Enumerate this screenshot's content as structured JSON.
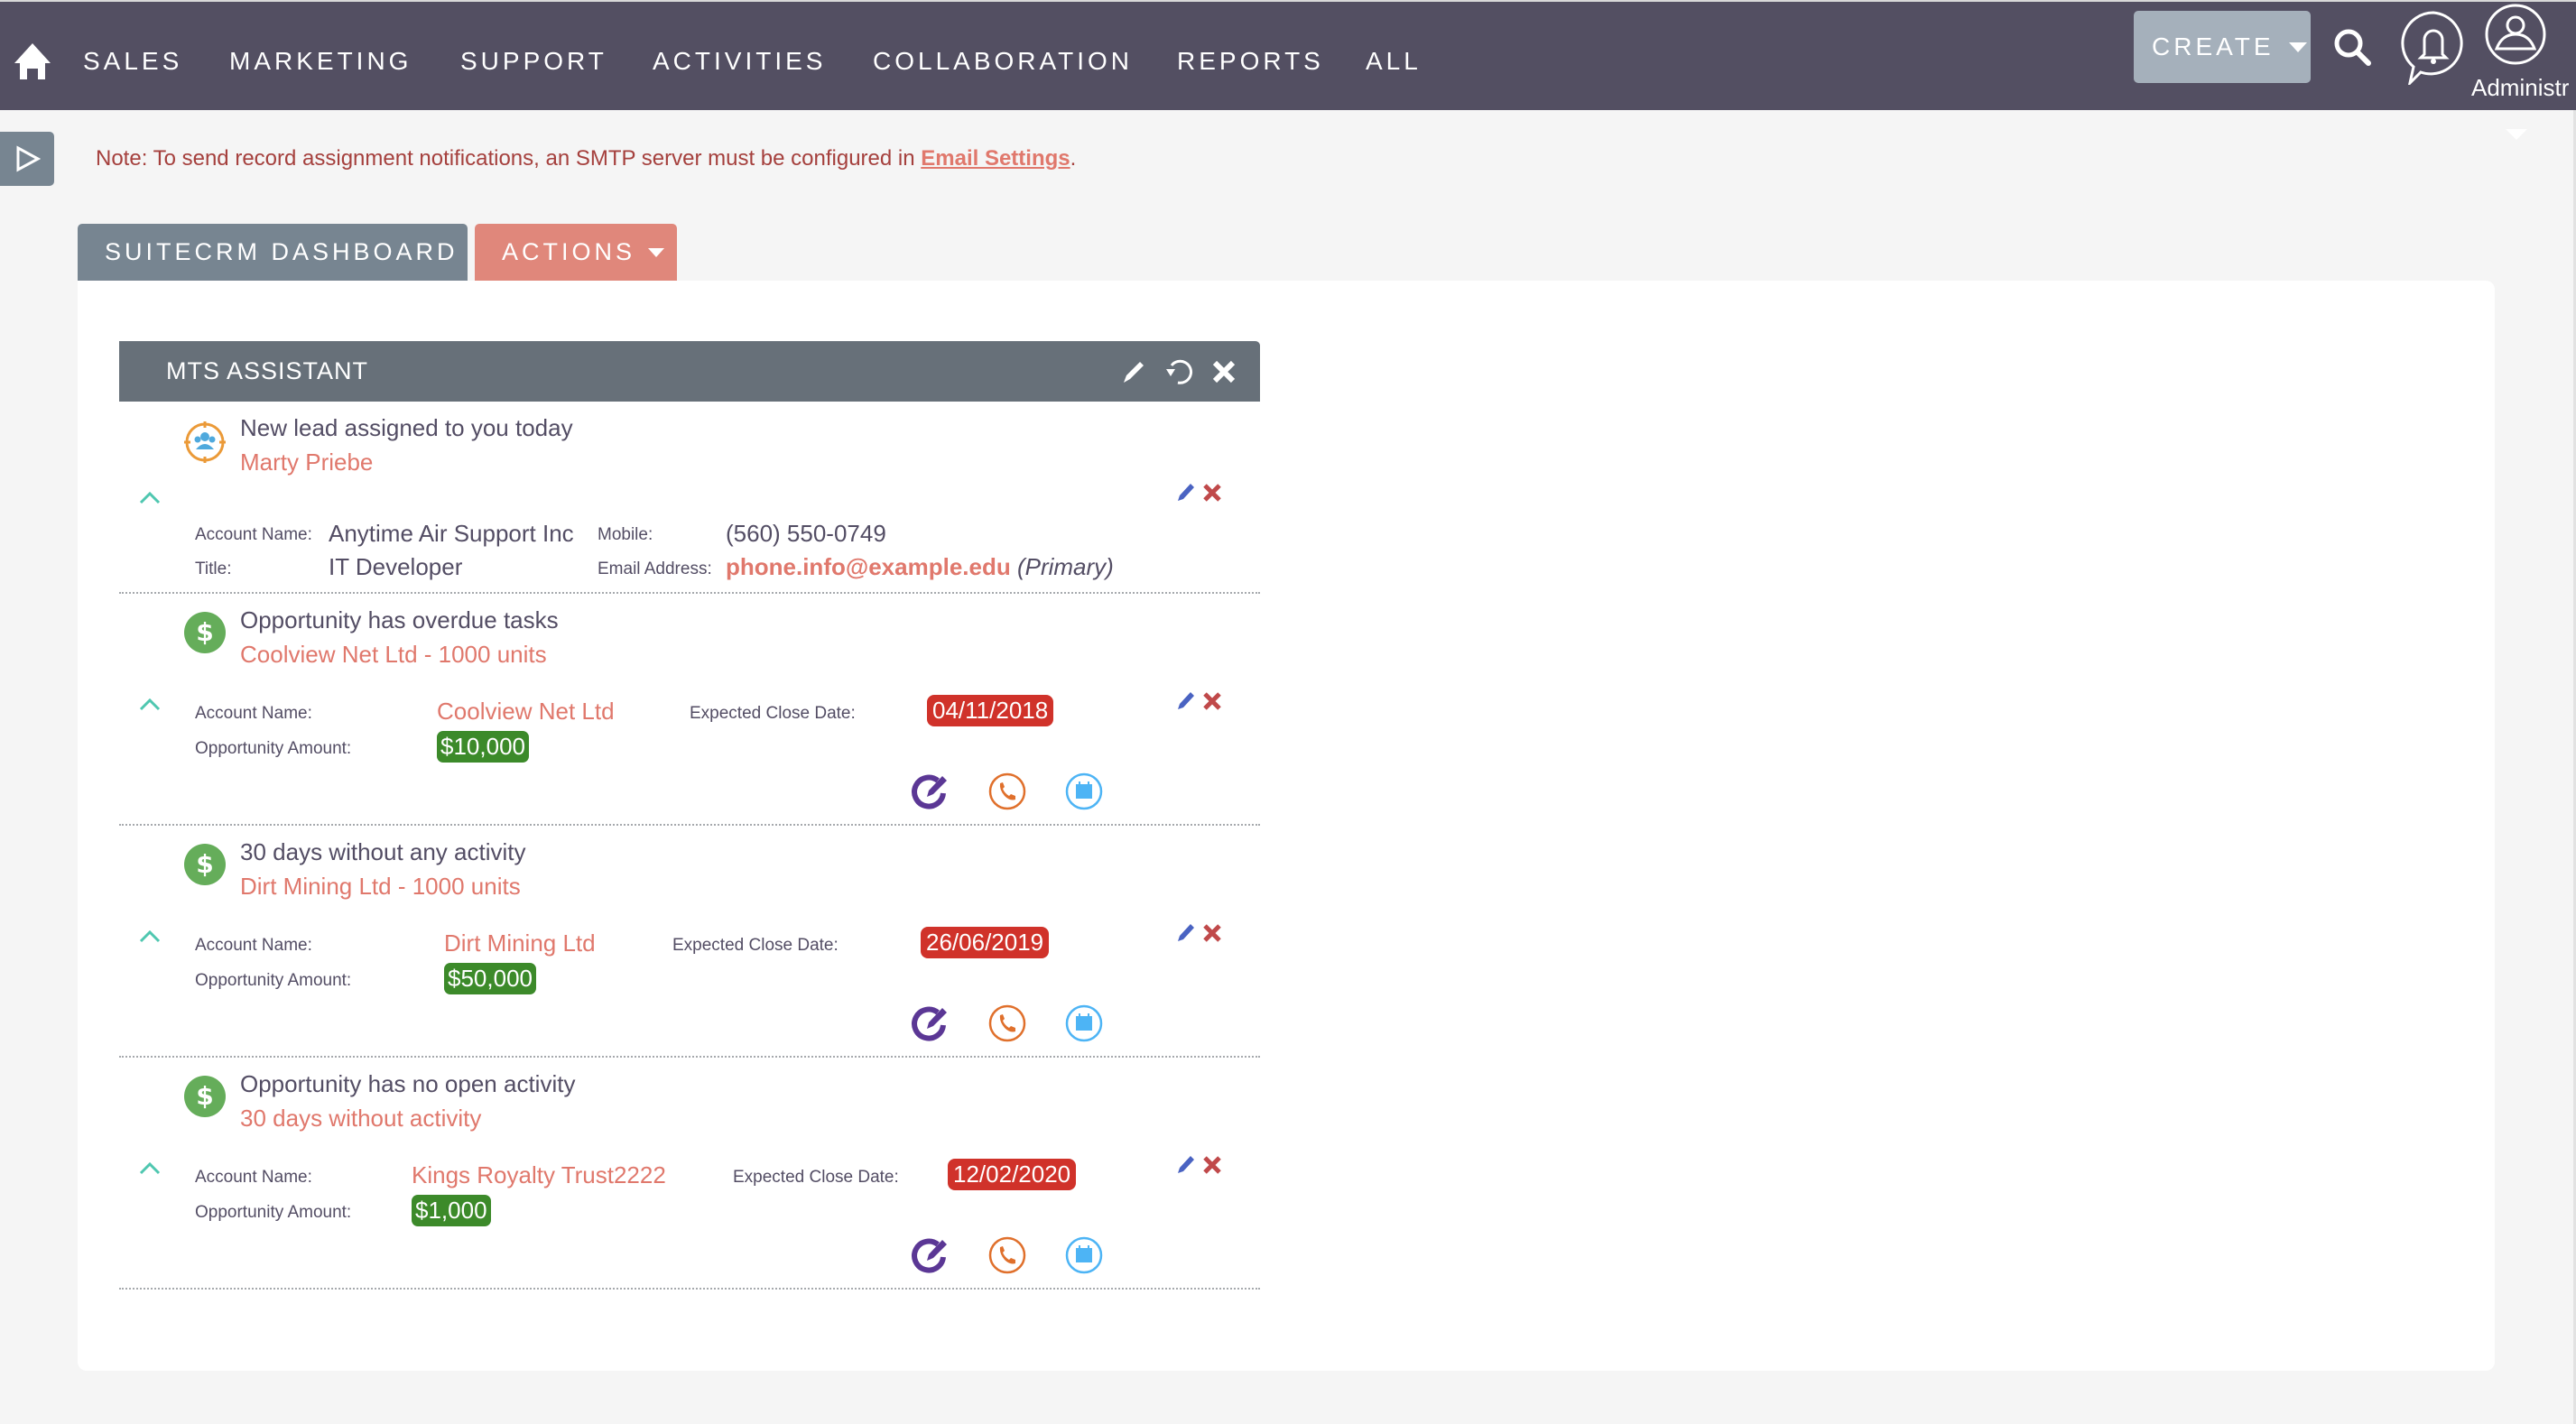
{
  "nav": {
    "items": [
      "SALES",
      "MARKETING",
      "SUPPORT",
      "ACTIVITIES",
      "COLLABORATION",
      "REPORTS",
      "ALL"
    ],
    "create_label": "CREATE",
    "user_label": "Administr"
  },
  "notice": {
    "text": "Note: To send record assignment notifications, an SMTP server must be configured in ",
    "link": "Email Settings",
    "suffix": "."
  },
  "tabs": {
    "dashboard": "SUITECRM DASHBOARD",
    "actions": "ACTIONS"
  },
  "dashlet": {
    "title": "MTS ASSISTANT",
    "lead": {
      "title": "New lead assigned to you today",
      "link": "Marty Priebe",
      "account_label": "Account Name:",
      "account_value": "Anytime Air Support Inc",
      "title_label": "Title:",
      "title_value": "IT Developer",
      "mobile_label": "Mobile:",
      "mobile_value": "(560) 550-0749",
      "email_label": "Email Address:",
      "email_value": "phone.info@example.edu",
      "email_tag": "(Primary)"
    },
    "opportunities": [
      {
        "title": "Opportunity has overdue tasks",
        "link": "Coolview Net Ltd - 1000 units",
        "account_label": "Account Name:",
        "account_value": "Coolview Net Ltd",
        "amount_label": "Opportunity Amount:",
        "amount_value": "$10,000",
        "close_label": "Expected Close Date:",
        "close_value": "04/11/2018"
      },
      {
        "title": "30 days without any activity",
        "link": "Dirt Mining Ltd - 1000 units",
        "account_label": "Account Name:",
        "account_value": "Dirt Mining Ltd",
        "amount_label": "Opportunity Amount:",
        "amount_value": "$50,000",
        "close_label": "Expected Close Date:",
        "close_value": "26/06/2019"
      },
      {
        "title": "Opportunity has no open activity",
        "link": "30 days without activity",
        "account_label": "Account Name:",
        "account_value": "Kings Royalty Trust2222",
        "amount_label": "Opportunity Amount:",
        "amount_value": "$1,000",
        "close_label": "Expected Close Date:",
        "close_value": "12/02/2020"
      }
    ]
  },
  "colors": {
    "nav_bg": "#534f62",
    "accent_link": "#e0786c",
    "date_badge": "#d0322a",
    "amount_badge": "#3c8a2a",
    "task_icon": "#5b3795",
    "call_icon": "#e0702c",
    "meeting_icon": "#4db4f5"
  }
}
